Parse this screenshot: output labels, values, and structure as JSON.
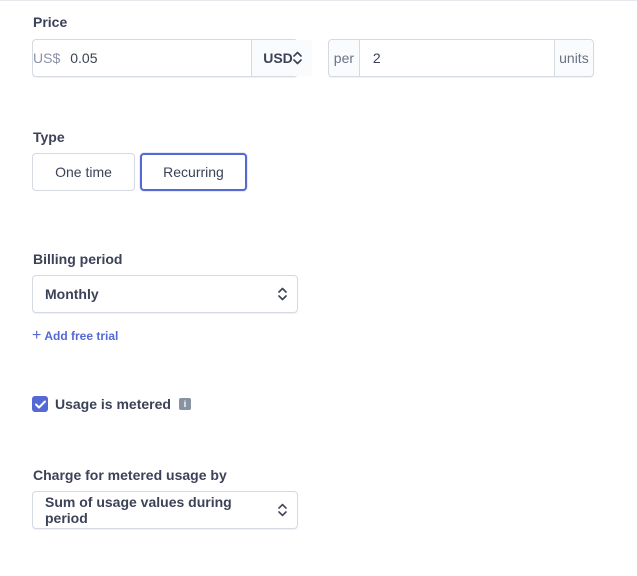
{
  "price": {
    "label": "Price",
    "currency_prefix": "US$",
    "amount": "0.05",
    "currency": "USD",
    "per_label": "per",
    "units_value": "2",
    "units_label": "units"
  },
  "type": {
    "label": "Type",
    "options": [
      "One time",
      "Recurring"
    ],
    "selected": "Recurring"
  },
  "billing": {
    "label": "Billing period",
    "value": "Monthly",
    "add_trial": "Add free trial"
  },
  "metered": {
    "label": "Usage is metered",
    "checked": true
  },
  "charge": {
    "label": "Charge for metered usage by",
    "value": "Sum of usage values during period"
  },
  "colors": {
    "accent": "#5469d4",
    "text": "#3c4257",
    "border": "#d5d9e2"
  }
}
